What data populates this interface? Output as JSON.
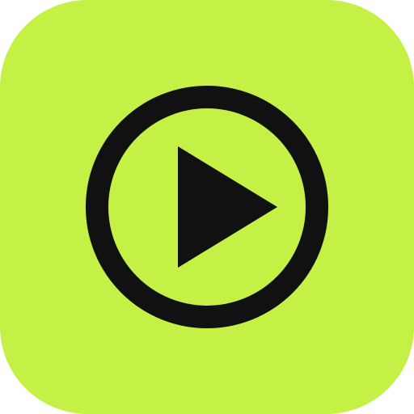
{
  "app_icon": {
    "icon": "play-circle-icon",
    "colors": {
      "background": "#c5f046",
      "glyph": "#111111"
    }
  }
}
